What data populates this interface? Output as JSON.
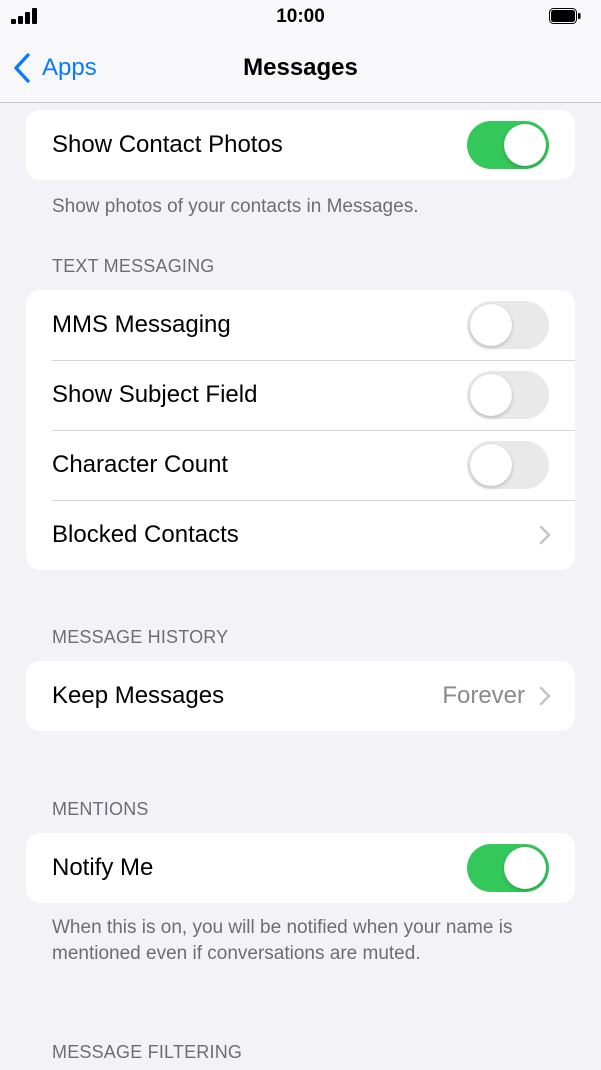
{
  "status_bar": {
    "time": "10:00"
  },
  "nav": {
    "back_label": "Apps",
    "title": "Messages"
  },
  "contact_photos": {
    "label": "Show Contact Photos",
    "enabled": true,
    "footer": "Show photos of your contacts in Messages."
  },
  "text_messaging": {
    "header": "TEXT MESSAGING",
    "items": [
      {
        "label": "MMS Messaging",
        "type": "toggle",
        "enabled": false
      },
      {
        "label": "Show Subject Field",
        "type": "toggle",
        "enabled": false
      },
      {
        "label": "Character Count",
        "type": "toggle",
        "enabled": false
      },
      {
        "label": "Blocked Contacts",
        "type": "link"
      }
    ]
  },
  "message_history": {
    "header": "MESSAGE HISTORY",
    "keep_messages": {
      "label": "Keep Messages",
      "value": "Forever"
    }
  },
  "mentions": {
    "header": "MENTIONS",
    "notify_me": {
      "label": "Notify Me",
      "enabled": true
    },
    "footer": "When this is on, you will be notified when your name is mentioned even if conversations are muted."
  },
  "message_filtering": {
    "header": "MESSAGE FILTERING"
  },
  "colors": {
    "accent": "#0a7aff",
    "toggle_on": "#34c759",
    "toggle_off": "#e9e9ea",
    "background": "#f2f2f7"
  }
}
